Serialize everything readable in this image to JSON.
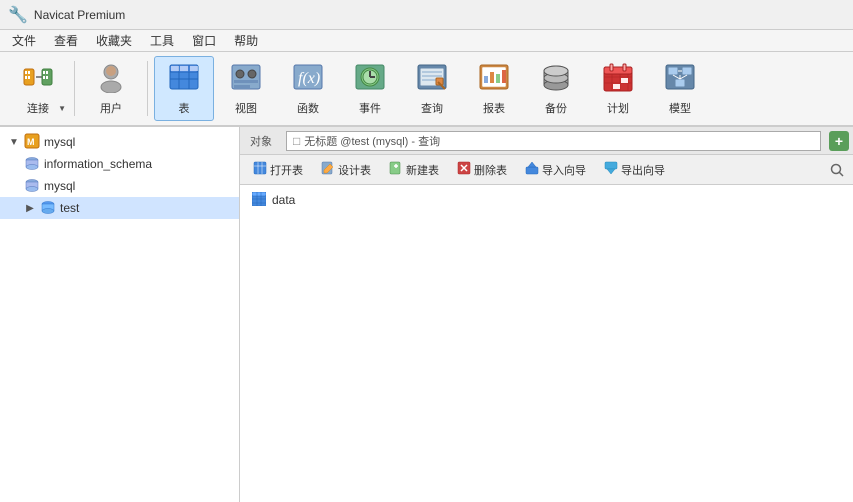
{
  "titleBar": {
    "appName": "Navicat Premium"
  },
  "menuBar": {
    "items": [
      "文件",
      "查看",
      "收藏夹",
      "工具",
      "窗口",
      "帮助"
    ]
  },
  "toolbar": {
    "buttons": [
      {
        "id": "connect",
        "label": "连接",
        "hasArrow": true
      },
      {
        "id": "user",
        "label": "用户"
      },
      {
        "id": "table",
        "label": "表",
        "active": true
      },
      {
        "id": "view",
        "label": "视图"
      },
      {
        "id": "function",
        "label": "函数"
      },
      {
        "id": "event",
        "label": "事件"
      },
      {
        "id": "query",
        "label": "查询"
      },
      {
        "id": "report",
        "label": "报表"
      },
      {
        "id": "backup",
        "label": "备份"
      },
      {
        "id": "schedule",
        "label": "计划"
      },
      {
        "id": "model",
        "label": "模型"
      }
    ]
  },
  "sidebar": {
    "items": [
      {
        "id": "mysql-root",
        "label": "mysql",
        "level": 0,
        "type": "connection",
        "expanded": true
      },
      {
        "id": "information_schema",
        "label": "information_schema",
        "level": 1,
        "type": "database"
      },
      {
        "id": "mysql-db",
        "label": "mysql",
        "level": 1,
        "type": "database"
      },
      {
        "id": "test",
        "label": "test",
        "level": 1,
        "type": "database",
        "selected": true,
        "expanded": true
      }
    ]
  },
  "rightPanel": {
    "tabLabel": "对象",
    "queryBarText": "无标题 @test (mysql) - 查询",
    "queryBarIcon": "□",
    "objectToolbar": {
      "buttons": [
        {
          "id": "open-table",
          "label": "打开表",
          "icon": "▶"
        },
        {
          "id": "design-table",
          "label": "设计表",
          "icon": "✏"
        },
        {
          "id": "new-table",
          "label": "新建表",
          "icon": "+"
        },
        {
          "id": "delete-table",
          "label": "删除表",
          "icon": "✖"
        },
        {
          "id": "import-wizard",
          "label": "导入向导",
          "icon": "⬇"
        },
        {
          "id": "export-wizard",
          "label": "导出向导",
          "icon": "⬆"
        }
      ]
    },
    "objectList": [
      {
        "id": "data-table",
        "label": "data",
        "icon": "table"
      }
    ]
  }
}
